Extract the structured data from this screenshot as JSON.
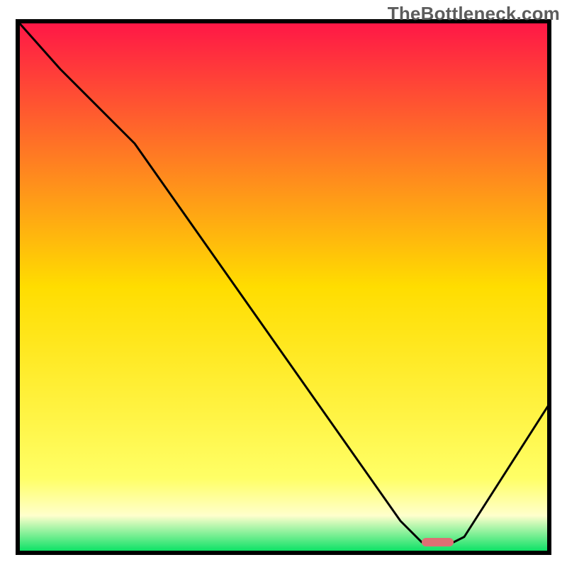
{
  "watermark": "TheBottleneck.com",
  "chart_data": {
    "type": "line",
    "title": "",
    "xlabel": "",
    "ylabel": "",
    "xlim": [
      0,
      100
    ],
    "ylim": [
      0,
      100
    ],
    "x": [
      0,
      8,
      22,
      72,
      76,
      82,
      84,
      100
    ],
    "values": [
      100,
      91,
      77,
      6,
      2,
      2,
      3,
      28
    ],
    "marker": {
      "x_range": [
        76,
        82
      ],
      "y": 2,
      "color": "#de6f74"
    },
    "gradient_stops": [
      {
        "offset": 0,
        "color": "#ff1647"
      },
      {
        "offset": 50,
        "color": "#ffdd00"
      },
      {
        "offset": 86,
        "color": "#ffff66"
      },
      {
        "offset": 93,
        "color": "#ffffcc"
      },
      {
        "offset": 100,
        "color": "#00e060"
      }
    ],
    "border_color": "#000000",
    "line_color": "#000000"
  }
}
